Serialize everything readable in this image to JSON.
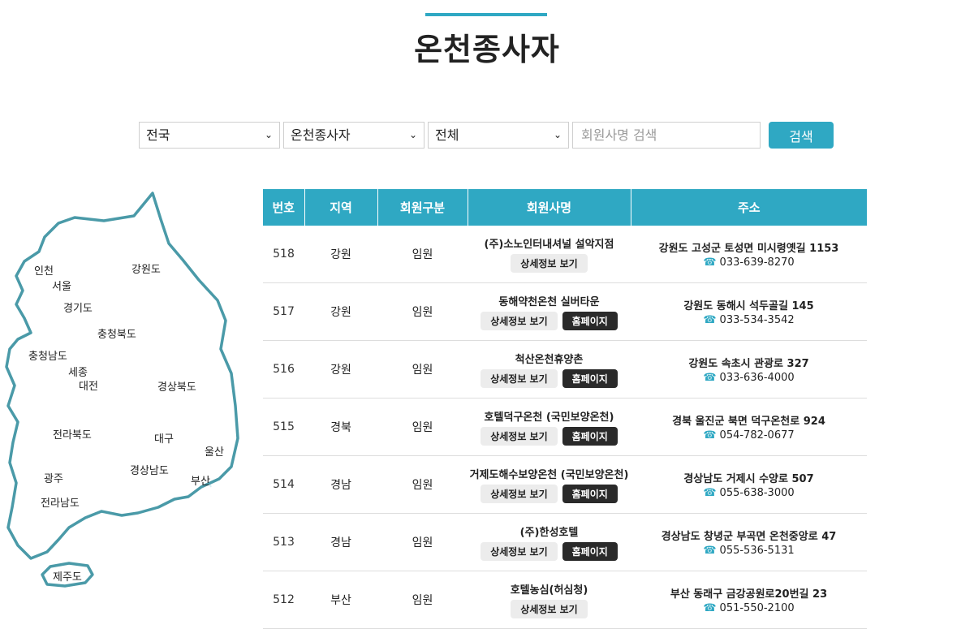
{
  "page": {
    "title": "온천종사자"
  },
  "search": {
    "region": "전국",
    "category": "온천종사자",
    "type": "전체",
    "placeholder": "회원사명 검색",
    "button": "검색"
  },
  "map": {
    "regions": [
      "인천",
      "서울",
      "경기도",
      "강원도",
      "충청북도",
      "충청남도",
      "세종",
      "대전",
      "경상북도",
      "전라북도",
      "대구",
      "울산",
      "경상남도",
      "부산",
      "광주",
      "전라남도",
      "제주도"
    ]
  },
  "table": {
    "headers": [
      "번호",
      "지역",
      "회원구분",
      "회원사명",
      "주소"
    ],
    "detail_label": "상세정보 보기",
    "home_label": "홈페이지",
    "rows": [
      {
        "no": "518",
        "region": "강원",
        "type": "임원",
        "name": "(주)소노인터내셔널 설악지점",
        "home": false,
        "address": "강원도 고성군 토성면 미시령옛길 1153",
        "phone": "033-639-8270"
      },
      {
        "no": "517",
        "region": "강원",
        "type": "임원",
        "name": "동해약천온천 실버타운",
        "home": true,
        "address": "강원도 동해시 석두골길 145",
        "phone": "033-534-3542"
      },
      {
        "no": "516",
        "region": "강원",
        "type": "임원",
        "name": "척산온천휴양촌",
        "home": true,
        "address": "강원도 속초시 관광로 327",
        "phone": "033-636-4000"
      },
      {
        "no": "515",
        "region": "경북",
        "type": "임원",
        "name": "호텔덕구온천 (국민보양온천)",
        "home": true,
        "address": "경북 울진군 북면 덕구온천로 924",
        "phone": "054-782-0677"
      },
      {
        "no": "514",
        "region": "경남",
        "type": "임원",
        "name": "거제도해수보양온천 (국민보양온천)",
        "home": true,
        "address": "경상남도 거제시 수양로 507",
        "phone": "055-638-3000"
      },
      {
        "no": "513",
        "region": "경남",
        "type": "임원",
        "name": "(주)한성호텔",
        "home": true,
        "address": "경상남도 창녕군 부곡면 온천중앙로 47",
        "phone": "055-536-5131"
      },
      {
        "no": "512",
        "region": "부산",
        "type": "임원",
        "name": "호텔농심(허심청)",
        "home": false,
        "address": "부산 동래구 금강공원로20번길 23",
        "phone": "051-550-2100"
      }
    ]
  }
}
